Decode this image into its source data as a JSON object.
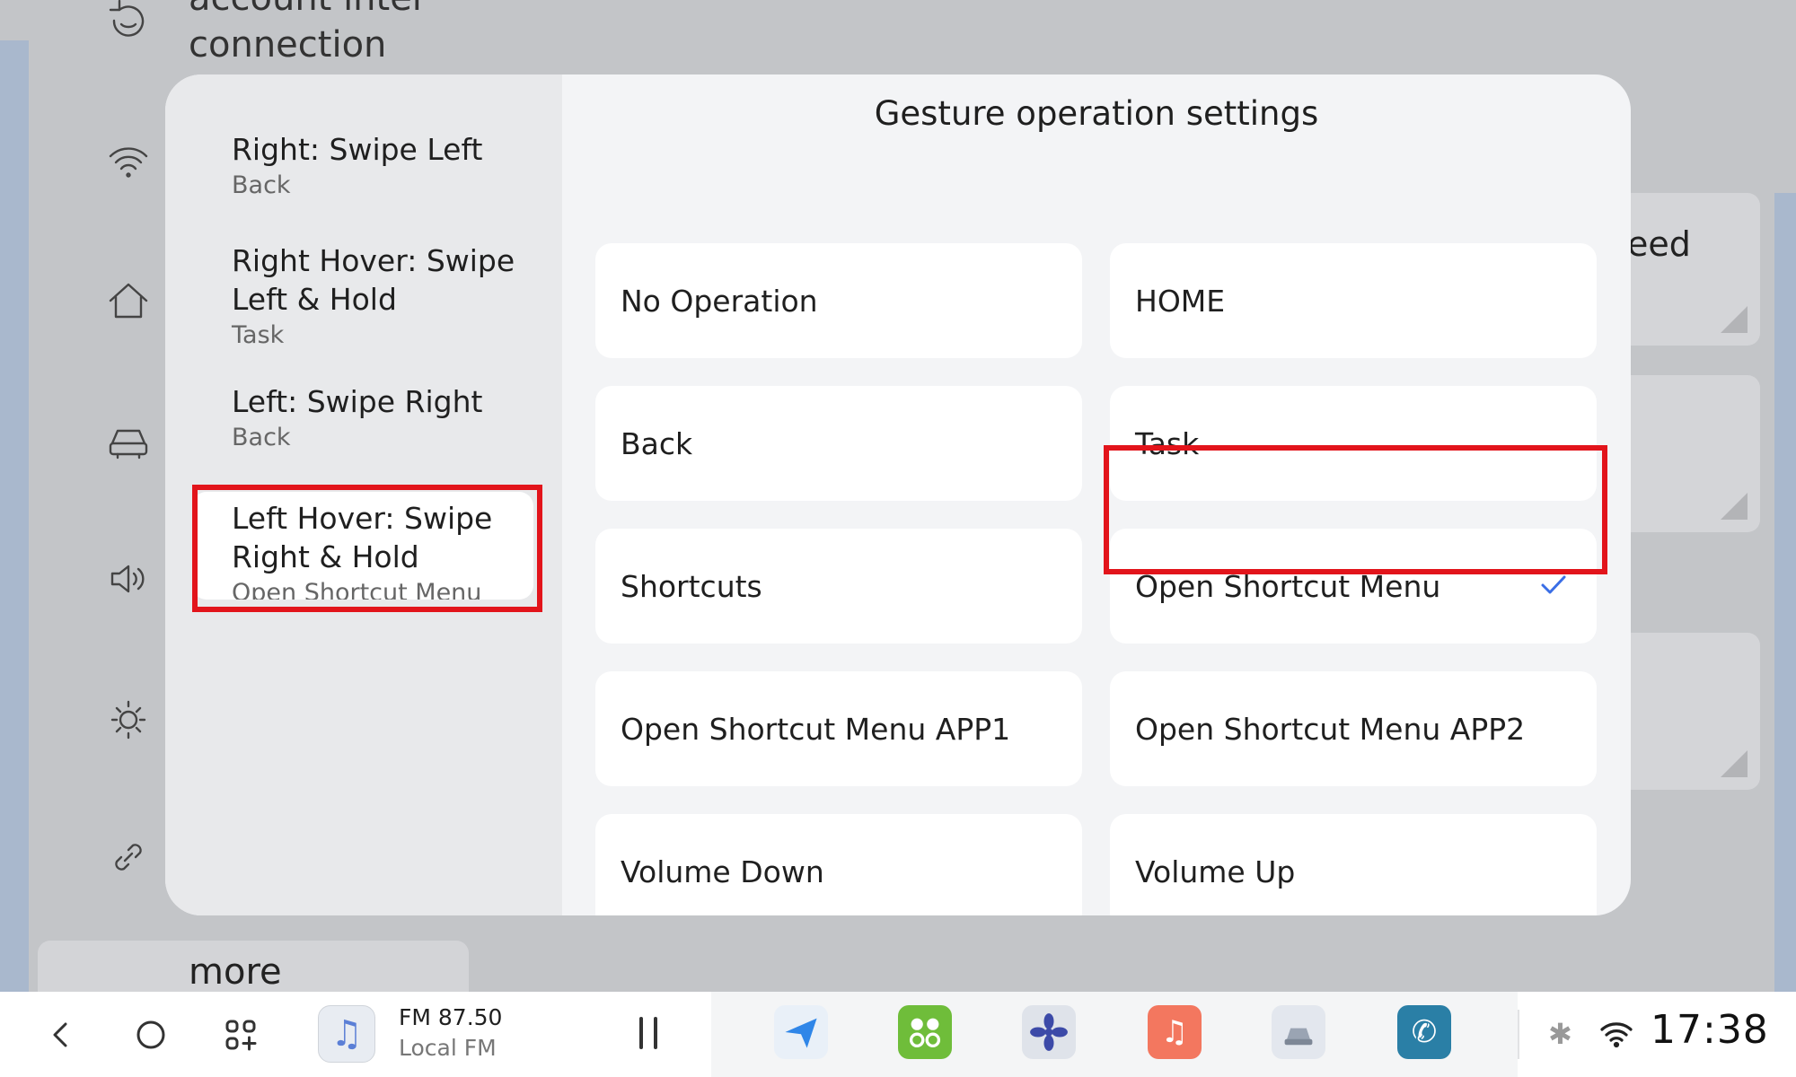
{
  "background": {
    "top_text_line1": "account inter",
    "top_text_line2": "connection",
    "more_label": "more",
    "card_label": "eed",
    "sidebar_icons": [
      "face-id-icon",
      "wifi-icon",
      "home-icon",
      "car-icon",
      "speaker-icon",
      "brightness-icon",
      "link-icon"
    ]
  },
  "dialog": {
    "title": "Gesture operation settings",
    "gestures": [
      {
        "title": "Right: Swipe Left",
        "value": "Back"
      },
      {
        "title": "Right Hover: Swipe Left & Hold",
        "value": "Task"
      },
      {
        "title": "Left: Swipe Right",
        "value": "Back"
      },
      {
        "title": "Left Hover: Swipe Right & Hold",
        "value": "Open Shortcut Menu"
      }
    ],
    "selected_gesture_index": 3,
    "options": [
      "No Operation",
      "HOME",
      "Back",
      "Task",
      "Shortcuts",
      "Open Shortcut Menu",
      "Open Shortcut Menu APP1",
      "Open Shortcut Menu APP2",
      "Volume Down",
      "Volume Up"
    ],
    "selected_option": "Open Shortcut Menu",
    "highlight_color": "#e2141b",
    "check_color": "#3a6ee6"
  },
  "dock": {
    "radio_title": "FM 87.50",
    "radio_subtitle": "Local FM",
    "apps": [
      "navigation-app-icon",
      "apps-grid-app-icon",
      "fan-app-icon",
      "music-app-icon",
      "car-app-icon",
      "phone-app-icon"
    ],
    "time": "17:38"
  }
}
